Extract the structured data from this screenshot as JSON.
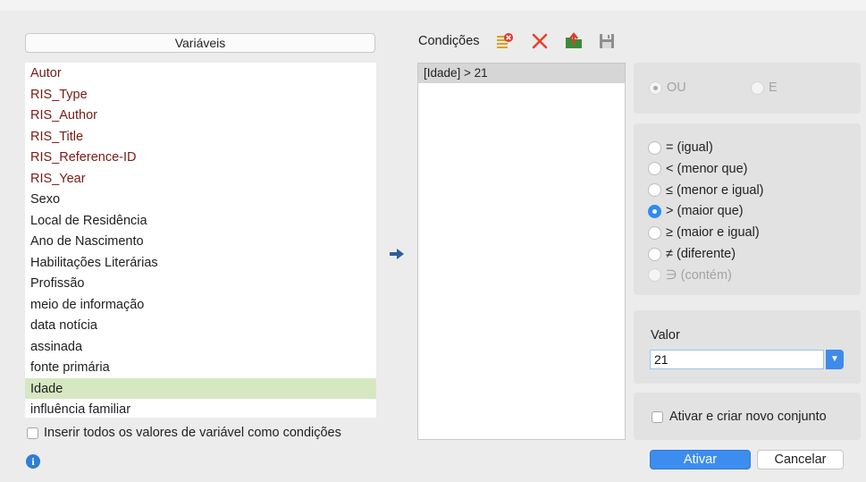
{
  "variables": {
    "header": "Variáveis",
    "items": [
      {
        "label": "Autor",
        "system": true
      },
      {
        "label": "RIS_Type",
        "system": true
      },
      {
        "label": "RIS_Author",
        "system": true
      },
      {
        "label": "RIS_Title",
        "system": true
      },
      {
        "label": "RIS_Reference-ID",
        "system": true
      },
      {
        "label": "RIS_Year",
        "system": true
      },
      {
        "label": "Sexo",
        "system": false
      },
      {
        "label": "Local de Residência",
        "system": false
      },
      {
        "label": "Ano de Nascimento",
        "system": false
      },
      {
        "label": "Habilitações Literárias",
        "system": false
      },
      {
        "label": "Profissão",
        "system": false
      },
      {
        "label": "meio de informação",
        "system": false
      },
      {
        "label": "data notícia",
        "system": false
      },
      {
        "label": "assinada",
        "system": false
      },
      {
        "label": "fonte primária",
        "system": false
      },
      {
        "label": "Idade",
        "system": false,
        "selected": true
      },
      {
        "label": "influência familiar",
        "system": false
      }
    ],
    "insert_all_label": "Inserir todos os valores de variável como condições",
    "insert_all_checked": false
  },
  "conditions": {
    "title": "Condições",
    "items": [
      "[Idade] > 21"
    ],
    "toolbar_icons": [
      "clear-list-icon",
      "delete-icon",
      "open-set-icon",
      "save-icon"
    ]
  },
  "logic": {
    "or_label": "OU",
    "and_label": "E"
  },
  "operators": [
    {
      "label": "= (igual)",
      "checked": false,
      "disabled": false
    },
    {
      "label": "< (menor que)",
      "checked": false,
      "disabled": false
    },
    {
      "label": "≤ (menor e igual)",
      "checked": false,
      "disabled": false
    },
    {
      "label": "> (maior que)",
      "checked": true,
      "disabled": false
    },
    {
      "label": "≥ (maior e igual)",
      "checked": false,
      "disabled": false
    },
    {
      "label": "≠ (diferente)",
      "checked": false,
      "disabled": false
    },
    {
      "label": "∋ (contém)",
      "checked": false,
      "disabled": true
    }
  ],
  "value": {
    "label": "Valor",
    "current": "21"
  },
  "activate_new_set_label": "Ativar e criar novo conjunto",
  "buttons": {
    "primary": "Ativar",
    "cancel": "Cancelar"
  },
  "colors": {
    "accent": "#3d8df0",
    "system_variable": "#7a1a12",
    "selected_row": "#d5e8c2",
    "delete": "#e8412c"
  }
}
